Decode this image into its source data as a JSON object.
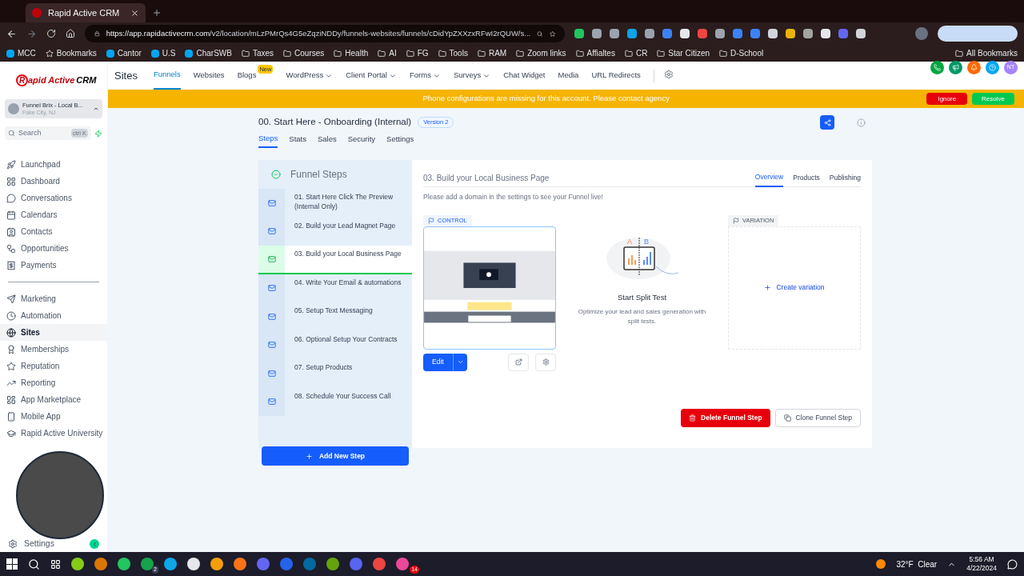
{
  "browser": {
    "tab_title": "Rapid Active CRM",
    "url_host": "https://app.rapidactivecrm.com",
    "url_path": "/v2/location/mLzPMrQs4G5eZqziNDDy/funnels-websites/funnels/cDidYpZXXzxRFwI2rQUW/s...",
    "bookmarks": [
      {
        "label": "MCC",
        "kind": "app"
      },
      {
        "label": "Bookmarks",
        "kind": "star"
      },
      {
        "label": "Cantor",
        "kind": "app"
      },
      {
        "label": "U.S",
        "kind": "app"
      },
      {
        "label": "CharSWB",
        "kind": "app"
      },
      {
        "label": "Taxes",
        "kind": "folder"
      },
      {
        "label": "Courses",
        "kind": "folder"
      },
      {
        "label": "Health",
        "kind": "folder"
      },
      {
        "label": "AI",
        "kind": "folder"
      },
      {
        "label": "FG",
        "kind": "folder"
      },
      {
        "label": "Tools",
        "kind": "folder"
      },
      {
        "label": "RAM",
        "kind": "folder"
      },
      {
        "label": "Zoom links",
        "kind": "folder"
      },
      {
        "label": "Affialtes",
        "kind": "folder"
      },
      {
        "label": "CR",
        "kind": "folder"
      },
      {
        "label": "Star Citizen",
        "kind": "folder"
      },
      {
        "label": "D-School",
        "kind": "folder"
      }
    ],
    "all_bookmarks": "All Bookmarks"
  },
  "sidebar": {
    "logo_mark": "R",
    "logo_text": "apid Active",
    "logo_suffix": "CRM",
    "location": {
      "name": "Funnel Brix - Local B...",
      "address": "Fake City, NJ"
    },
    "search": {
      "placeholder": "Search",
      "shortcut": "ctrl K"
    },
    "items": [
      {
        "label": "Launchpad",
        "selected": false
      },
      {
        "label": "Dashboard",
        "selected": false
      },
      {
        "label": "Conversations",
        "selected": false
      },
      {
        "label": "Calendars",
        "selected": false
      },
      {
        "label": "Contacts",
        "selected": false
      },
      {
        "label": "Opportunities",
        "selected": false
      },
      {
        "label": "Payments",
        "selected": false
      }
    ],
    "items_2": [
      {
        "label": "Marketing",
        "selected": false
      },
      {
        "label": "Automation",
        "selected": false
      },
      {
        "label": "Sites",
        "selected": true
      },
      {
        "label": "Memberships",
        "selected": false
      },
      {
        "label": "Reputation",
        "selected": false
      },
      {
        "label": "Reporting",
        "selected": false
      },
      {
        "label": "App Marketplace",
        "selected": false
      },
      {
        "label": "Mobile App",
        "selected": false
      },
      {
        "label": "Rapid Active University",
        "selected": false
      }
    ],
    "settings": "Settings"
  },
  "topnav": {
    "title": "Sites",
    "tabs": [
      {
        "label": "Funnels",
        "selected": true,
        "dropdown": false
      },
      {
        "label": "Websites",
        "selected": false,
        "dropdown": false
      },
      {
        "label": "Blogs",
        "selected": false,
        "dropdown": false,
        "badge": "New"
      },
      {
        "label": "WordPress",
        "selected": false,
        "dropdown": true
      },
      {
        "label": "Client Portal",
        "selected": false,
        "dropdown": true
      },
      {
        "label": "Forms",
        "selected": false,
        "dropdown": true
      },
      {
        "label": "Surveys",
        "selected": false,
        "dropdown": true
      },
      {
        "label": "Chat Widget",
        "selected": false,
        "dropdown": false
      },
      {
        "label": "Media",
        "selected": false,
        "dropdown": false
      },
      {
        "label": "URL Redirects",
        "selected": false,
        "dropdown": false
      }
    ],
    "avatar": "NT"
  },
  "banner": {
    "message": "Phone configurations are missing for this account. Please contact agency",
    "ignore": "Ignore",
    "resolve": "Resolve"
  },
  "funnel": {
    "title": "00. Start Here - Onboarding (Internal)",
    "version": "Version 2",
    "tabs": [
      {
        "label": "Steps",
        "selected": true
      },
      {
        "label": "Stats",
        "selected": false
      },
      {
        "label": "Sales",
        "selected": false
      },
      {
        "label": "Security",
        "selected": false
      },
      {
        "label": "Settings",
        "selected": false
      }
    ],
    "steps_heading": "Funnel Steps",
    "steps": [
      {
        "label": "01. Start Here Click The Preview (Internal Only)",
        "selected": false
      },
      {
        "label": "02. Build your Lead Magnet Page",
        "selected": false
      },
      {
        "label": "03. Build your Local Business Page",
        "selected": true
      },
      {
        "label": "04. Write Your Email & automations",
        "selected": false
      },
      {
        "label": "05. Setup Text Messaging",
        "selected": false
      },
      {
        "label": "06. Optional Setup Your Contracts",
        "selected": false
      },
      {
        "label": "07. Setup Products",
        "selected": false
      },
      {
        "label": "08. Schedule Your Success Call",
        "selected": false
      }
    ],
    "add_step": "Add New Step"
  },
  "step_panel": {
    "title": "03. Build your Local Business Page",
    "tabs": [
      {
        "label": "Overview",
        "selected": true
      },
      {
        "label": "Products",
        "selected": false
      },
      {
        "label": "Publishing",
        "selected": false
      }
    ],
    "notice": "Please add a domain in the settings to see your Funnel live!",
    "control_label": "CONTROL",
    "edit": "Edit",
    "split_a": "A",
    "split_b": "B",
    "split_title": "Start Split Test",
    "split_text": "Optimize your lead and sales generation with split tests.",
    "variation_label": "VARIATION",
    "create_variation": "Create variation",
    "delete": "Delete Funnel Step",
    "clone": "Clone Funnel Step"
  },
  "taskbar": {
    "badges": [
      "2",
      "14"
    ],
    "weather": "32°F  Clear",
    "time": "5:56 AM",
    "date": "4/22/2024"
  }
}
